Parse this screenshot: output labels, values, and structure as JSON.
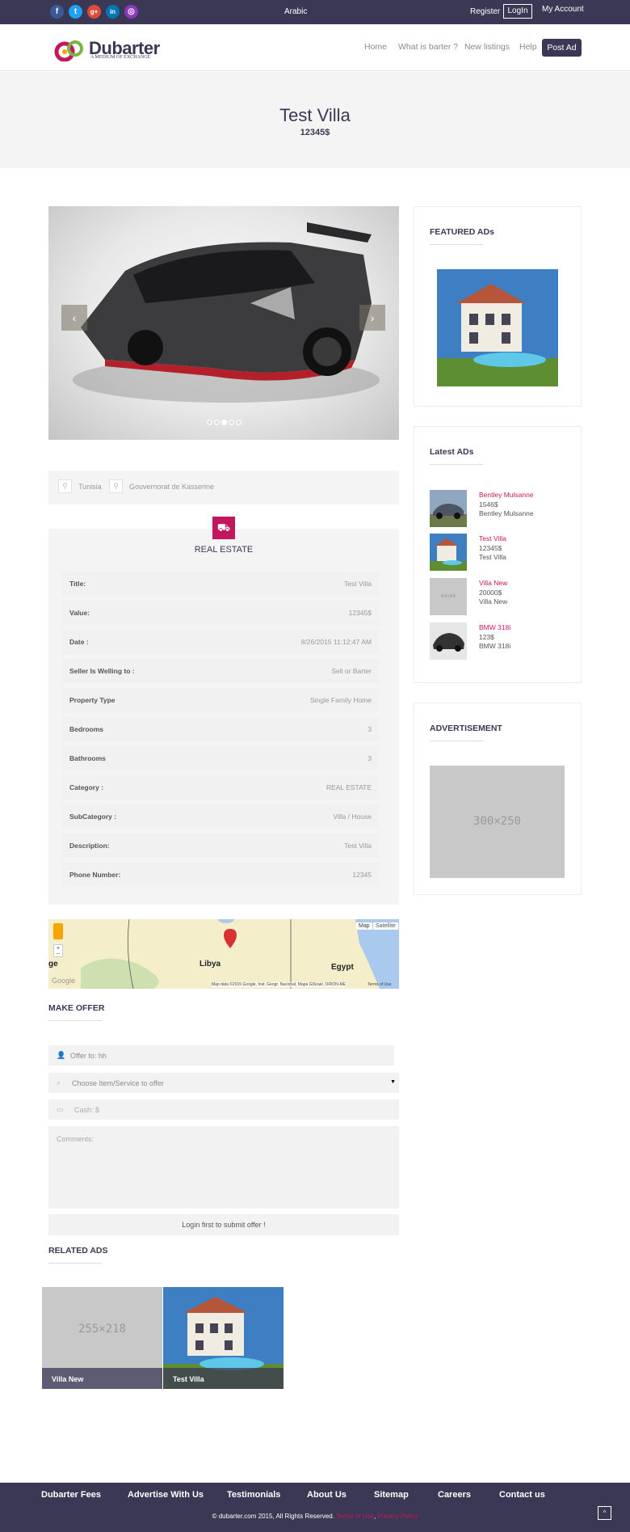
{
  "topbar": {
    "social": [
      {
        "icon": "facebook-icon",
        "glyph": "f",
        "color": "#3b5998"
      },
      {
        "icon": "twitter-icon",
        "glyph": "t",
        "color": "#1da1f2"
      },
      {
        "icon": "google-plus-icon",
        "glyph": "g+",
        "color": "#dd4b39"
      },
      {
        "icon": "linkedin-icon",
        "glyph": "in",
        "color": "#0077b5"
      },
      {
        "icon": "instagram-icon",
        "glyph": "◎",
        "color": "#8a3ab9"
      }
    ],
    "language": "Arabic",
    "register": "Register",
    "login": "LogIn",
    "my_account": "My Account"
  },
  "header": {
    "logo_text": "Dubarter",
    "logo_tagline": "A MEDIUM OF EXCHANGE",
    "nav": [
      "Home",
      "What is barter ?",
      "New listings",
      "Help"
    ],
    "post_ad": "Post Ad"
  },
  "hero": {
    "title": "Test Villa",
    "price": "12345$"
  },
  "slider": {
    "prev": "‹",
    "next": "›",
    "dots": 5,
    "active_dot": 3
  },
  "location": {
    "country": "Tunisia",
    "region": "Gouvernorat de Kasserine"
  },
  "details": {
    "category_title": "REAL ESTATE",
    "rows": [
      {
        "label": "Title:",
        "value": "Test Villa"
      },
      {
        "label": "Value:",
        "value": "12345$"
      },
      {
        "label": "Date :",
        "value": "8/26/2015 11:12:47 AM"
      },
      {
        "label": "Seller Is Welling to :",
        "value": "Sell or Barter"
      },
      {
        "label": "Property Type",
        "value": "Single Family Home"
      },
      {
        "label": "Bedrooms",
        "value": "3"
      },
      {
        "label": "Bathrooms",
        "value": "3"
      },
      {
        "label": "Category :",
        "value": "REAL ESTATE"
      },
      {
        "label": "SubCategory :",
        "value": "Villa / House"
      },
      {
        "label": "Description:",
        "value": "Test Villa"
      },
      {
        "label": "Phone Number:",
        "value": "12345"
      }
    ]
  },
  "map": {
    "map_btn": "Map",
    "satellite_btn": "Satellite",
    "label_libya": "Libya",
    "label_egypt": "Egypt",
    "label_partial": "ge",
    "google": "Google",
    "attribution": "Map data ©2015 Google, Inst. Geogr. Nacional, Mapa GISrael, ORION-ME",
    "terms": "Terms of Use"
  },
  "offer": {
    "title": "MAKE OFFER",
    "offer_to": "Offer to: hh",
    "choose_item": "Choose Item/Service to offer",
    "cash_placeholder": "Cash: $",
    "comments_placeholder": "Comments:",
    "submit": "Login first to submit offer !"
  },
  "related": {
    "title": "RELATED ADs",
    "items": [
      {
        "name": "Villa New",
        "placeholder": "255×218"
      },
      {
        "name": "Test Villa"
      }
    ]
  },
  "featured": {
    "title": "FEATURED ADs"
  },
  "latest": {
    "title": "Latest ADs",
    "items": [
      {
        "title": "Bentley Mulsanne",
        "price": "1546$",
        "name": "Bentley Mulsanne"
      },
      {
        "title": "Test Villa",
        "price": "12345$",
        "name": "Test Villa"
      },
      {
        "title": "Villa New",
        "price": "20000$",
        "name": "Villa New",
        "placeholder": "64×64"
      },
      {
        "title": "BMW 318i",
        "price": "123$",
        "name": "BMW 318i"
      }
    ]
  },
  "advertisement": {
    "title": "ADVERTISEMENT",
    "placeholder": "300×250"
  },
  "footer": {
    "links": [
      "Dubarter Fees",
      "Advertise With Us",
      "Testimonials",
      "About Us",
      "Sitemap",
      "Careers",
      "Contact us"
    ],
    "copyright": "© dubarter.com 2015, All Rights Reserved.",
    "terms": "Terms of Use",
    "separator": ",",
    "privacy": "Privacy Policy",
    "to_top": "^"
  },
  "colors": {
    "brand": "#3b3855",
    "accent": "#c2185b"
  }
}
